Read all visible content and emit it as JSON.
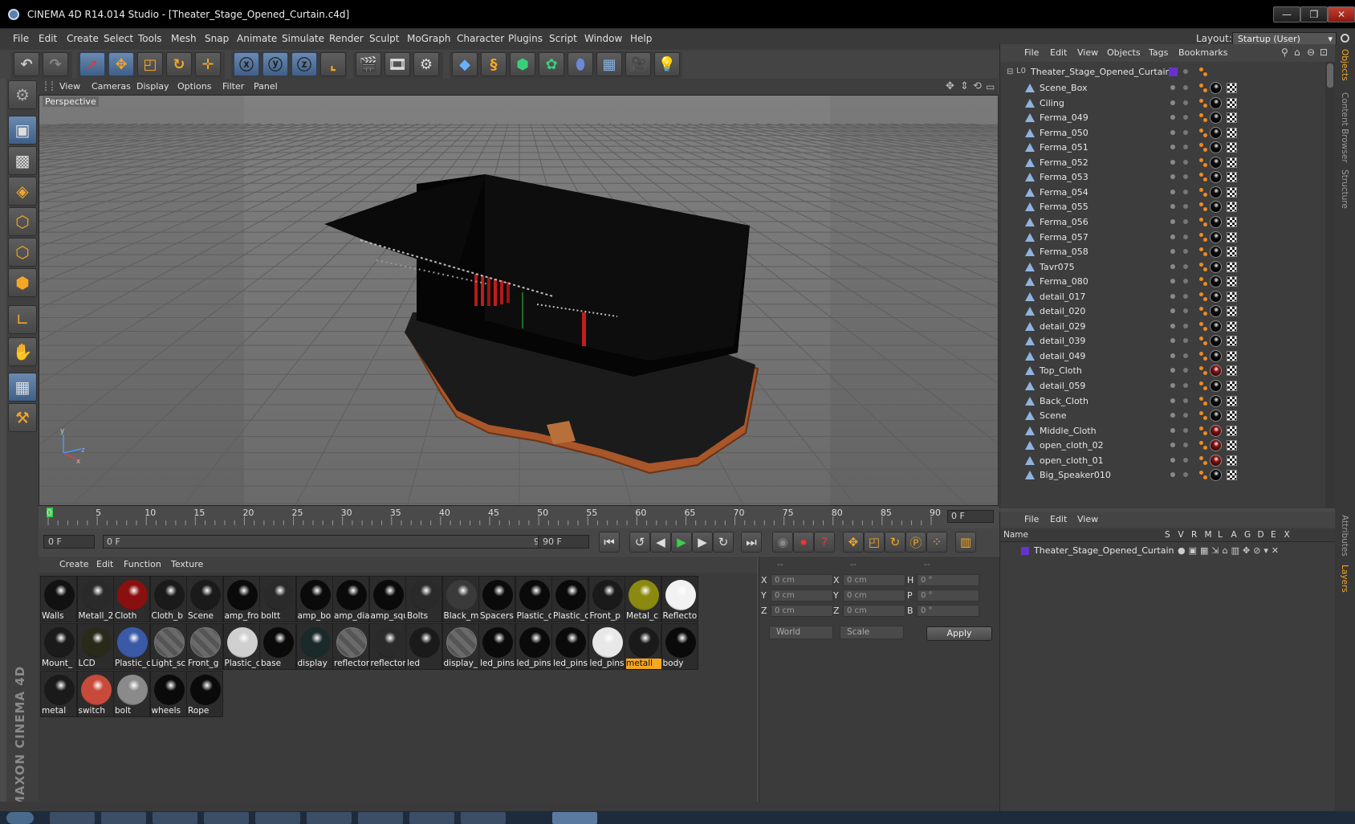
{
  "window": {
    "title": "CINEMA 4D R14.014 Studio - [Theater_Stage_Opened_Curtain.c4d]",
    "minimize": "—",
    "maximize": "❐",
    "close": "✕"
  },
  "menubar": {
    "items": [
      "File",
      "Edit",
      "Create",
      "Select",
      "Tools",
      "Mesh",
      "Snap",
      "Animate",
      "Simulate",
      "Render",
      "Sculpt",
      "MoGraph",
      "Character",
      "Plugins",
      "Script",
      "Window",
      "Help"
    ],
    "layout_label": "Layout:",
    "layout_value": "Startup (User)"
  },
  "viewport": {
    "menu": [
      "View",
      "Cameras",
      "Display",
      "Options",
      "Filter",
      "Panel"
    ],
    "label": "Perspective"
  },
  "timeline": {
    "ticks": [
      "0",
      "5",
      "10",
      "15",
      "20",
      "25",
      "30",
      "35",
      "40",
      "45",
      "50",
      "55",
      "60",
      "65",
      "70",
      "75",
      "80",
      "85",
      "90"
    ],
    "current_frame": "0 F"
  },
  "playback": {
    "start": "0 F",
    "range_start": "0 F",
    "range_end": "90 F",
    "end": "90 F"
  },
  "materials": {
    "menu": [
      "Create",
      "Edit",
      "Function",
      "Texture"
    ],
    "items": [
      {
        "label": "Walls",
        "color": "#111"
      },
      {
        "label": "Metall_2",
        "color": "#2a2a2a"
      },
      {
        "label": "Cloth",
        "color": "#8a1010"
      },
      {
        "label": "Cloth_b",
        "color": "#1a1a1a"
      },
      {
        "label": "Scene",
        "color": "#1a1a1a"
      },
      {
        "label": "amp_fro",
        "color": "#0a0a0a"
      },
      {
        "label": "boltt",
        "color": "#2a2a2a"
      },
      {
        "label": "amp_bo",
        "color": "#0a0a0a"
      },
      {
        "label": "amp_dia",
        "color": "#0a0a0a"
      },
      {
        "label": "amp_squ",
        "color": "#0a0a0a"
      },
      {
        "label": "Bolts",
        "color": "#2a2a2a"
      },
      {
        "label": "Black_m",
        "color": "#3a3a3a"
      },
      {
        "label": "Spacers",
        "color": "#0a0a0a"
      },
      {
        "label": "Plastic_c",
        "color": "#0a0a0a"
      },
      {
        "label": "Plastic_c",
        "color": "#0a0a0a"
      },
      {
        "label": "Front_p",
        "color": "#1a1a1a"
      },
      {
        "label": "Metal_c",
        "color": "#8a8a10"
      },
      {
        "label": "Reflecto",
        "color": "#f2f2f2"
      },
      {
        "label": "Mount_",
        "color": "#1a1a1a"
      },
      {
        "label": "LCD",
        "color": "#2a2a1a"
      },
      {
        "label": "Plastic_c",
        "color": "#3a5aa8"
      },
      {
        "label": "Light_sc",
        "color": "checker"
      },
      {
        "label": "Front_g",
        "color": "checker"
      },
      {
        "label": "Plastic_c",
        "color": "#cfcfcf"
      },
      {
        "label": "base",
        "color": "#0a0a0a"
      },
      {
        "label": "display",
        "color": "#1a2a2a"
      },
      {
        "label": "reflector",
        "color": "checker"
      },
      {
        "label": "reflector",
        "color": "#2a2a2a"
      },
      {
        "label": "led",
        "color": "#1a1a1a"
      },
      {
        "label": "display_",
        "color": "checker"
      },
      {
        "label": "led_pins",
        "color": "#0a0a0a"
      },
      {
        "label": "led_pins",
        "color": "#0a0a0a"
      },
      {
        "label": "led_pins",
        "color": "#0a0a0a"
      },
      {
        "label": "led_pins",
        "color": "#e8e8e8"
      },
      {
        "label": "metall",
        "color": "#1a1a1a",
        "selected": true
      },
      {
        "label": "body",
        "color": "#0a0a0a"
      },
      {
        "label": "metal",
        "color": "#1a1a1a"
      },
      {
        "label": "switch",
        "color": "#c84a3a"
      },
      {
        "label": "bolt",
        "color": "#8a8a8a"
      },
      {
        "label": "wheels",
        "color": "#0a0a0a"
      },
      {
        "label": "Rope",
        "color": "#0a0a0a"
      }
    ]
  },
  "coords": {
    "headers": [
      "--",
      "--",
      "--"
    ],
    "rows": [
      {
        "a": "X",
        "av": "0 cm",
        "b": "X",
        "bv": "0 cm",
        "c": "H",
        "cv": "0 °"
      },
      {
        "a": "Y",
        "av": "0 cm",
        "b": "Y",
        "bv": "0 cm",
        "c": "P",
        "cv": "0 °"
      },
      {
        "a": "Z",
        "av": "0 cm",
        "b": "Z",
        "bv": "0 cm",
        "c": "B",
        "cv": "0 °"
      }
    ],
    "mode": "World",
    "type": "Scale",
    "apply": "Apply"
  },
  "objects": {
    "menu": [
      "File",
      "Edit",
      "View",
      "Objects",
      "Tags",
      "Bookmarks"
    ],
    "root": "Theater_Stage_Opened_Curtain",
    "items": [
      {
        "name": "Scene_Box",
        "mat": "#0a0a0a"
      },
      {
        "name": "Ciling",
        "mat": "#0a0a0a"
      },
      {
        "name": "Ferma_049",
        "mat": "#0a0a0a"
      },
      {
        "name": "Ferma_050",
        "mat": "#0a0a0a"
      },
      {
        "name": "Ferma_051",
        "mat": "#0a0a0a"
      },
      {
        "name": "Ferma_052",
        "mat": "#0a0a0a"
      },
      {
        "name": "Ferma_053",
        "mat": "#0a0a0a"
      },
      {
        "name": "Ferma_054",
        "mat": "#0a0a0a"
      },
      {
        "name": "Ferma_055",
        "mat": "#0a0a0a"
      },
      {
        "name": "Ferma_056",
        "mat": "#0a0a0a"
      },
      {
        "name": "Ferma_057",
        "mat": "#0a0a0a"
      },
      {
        "name": "Ferma_058",
        "mat": "#0a0a0a"
      },
      {
        "name": "Tavr075",
        "mat": "#0a0a0a"
      },
      {
        "name": "Ferma_080",
        "mat": "#0a0a0a"
      },
      {
        "name": "detail_017",
        "mat": "#0a0a0a"
      },
      {
        "name": "detail_020",
        "mat": "#0a0a0a"
      },
      {
        "name": "detail_029",
        "mat": "#0a0a0a"
      },
      {
        "name": "detail_039",
        "mat": "#0a0a0a"
      },
      {
        "name": "detail_049",
        "mat": "#0a0a0a"
      },
      {
        "name": "Top_Cloth",
        "mat": "#8a1010"
      },
      {
        "name": "detail_059",
        "mat": "#0a0a0a"
      },
      {
        "name": "Back_Cloth",
        "mat": "#0a0a0a"
      },
      {
        "name": "Scene",
        "mat": "#0a0a0a"
      },
      {
        "name": "Middle_Cloth",
        "mat": "#8a1010"
      },
      {
        "name": "open_cloth_02",
        "mat": "#8a1010"
      },
      {
        "name": "open_cloth_01",
        "mat": "#8a1010"
      },
      {
        "name": "Big_Speaker010",
        "mat": "#0a0a0a"
      }
    ]
  },
  "layers": {
    "menu": [
      "File",
      "Edit",
      "View"
    ],
    "columns": [
      "Name",
      "S",
      "V",
      "R",
      "M",
      "L",
      "A",
      "G",
      "D",
      "E",
      "X"
    ],
    "row": "Theater_Stage_Opened_Curtain"
  },
  "right_tabs": [
    "Objects",
    "Content Browser",
    "Structure",
    "Attributes",
    "Layers"
  ],
  "maxon_logo": "MAXON CINEMA 4D",
  "colors": {
    "accent": "#f5a623",
    "selection": "#5c7fab"
  }
}
